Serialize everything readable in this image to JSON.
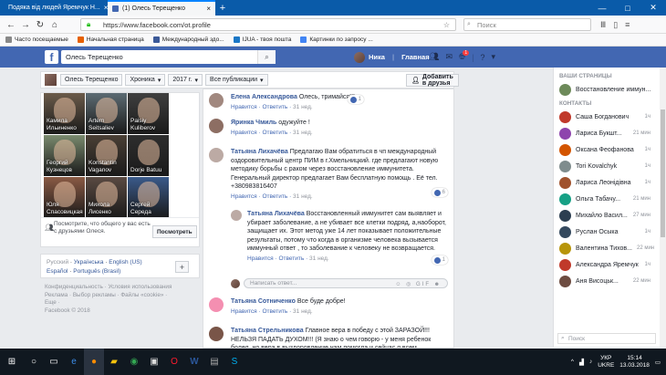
{
  "browser": {
    "tabs": [
      {
        "label": "Подяка від людей Яремчук Н...",
        "active": false
      },
      {
        "label": "(1) Олесь Терещенко",
        "active": true
      }
    ],
    "url": "https://www.facebook.com/ot.profile",
    "search_placeholder": "Поиск",
    "bookmarks": [
      {
        "label": "Часто посещаемые",
        "color": "#888888"
      },
      {
        "label": "Начальная страница",
        "color": "#e66000"
      },
      {
        "label": "Международный здо...",
        "color": "#3b5998"
      },
      {
        "label": "IJUA - твоя поштa",
        "color": "#1b77c6"
      },
      {
        "label": "Картинки по запросу ...",
        "color": "#4285f4"
      }
    ]
  },
  "facebook": {
    "search_value": "Олесь Терещенко",
    "user_name": "Ника",
    "home_label": "Главная",
    "notif_count": "1",
    "profile_name": "Олесь Терещенко",
    "timeline_label": "Хроника",
    "year": "2017 г.",
    "filter": "Все публикации",
    "add_friend": "Добавить в друзья"
  },
  "friends": [
    {
      "name": "Камила Ильиненко",
      "color": "#6b5b4a"
    },
    {
      "name": "Artem Seitsaliev",
      "color": "#5c6b73"
    },
    {
      "name": "Paisiy Kuliberov",
      "color": "#3f3f3f"
    },
    {
      "name": "Георгий Кузнецов",
      "color": "#7a8a6e"
    },
    {
      "name": "Konstantin Vaganov",
      "color": "#4a3f35"
    },
    {
      "name": "Dorje Batuu",
      "color": "#2e2e2e"
    },
    {
      "name": "Юля Спасовицкая",
      "color": "#8a5a44"
    },
    {
      "name": "Михола Лисенко",
      "color": "#5a4a42"
    },
    {
      "name": "Сергей Середа",
      "color": "#3a5a8a"
    }
  ],
  "find_friends": {
    "text": "Посмотрите, что общего у вас есть с друзьями Олеся.",
    "button": "Посмотреть"
  },
  "languages": {
    "current": "Русский",
    "others": [
      "Українська",
      "English (US)",
      "Español",
      "Português (Brasil)"
    ]
  },
  "footer": {
    "lines": [
      "Конфиденциальность · Условия использования",
      "Реклама · Выбор рекламы · Файлы «cookie» ·",
      "Еще ·",
      "Facebook © 2018"
    ]
  },
  "comments": [
    {
      "name": "Елена Александрова",
      "text": "Олесь, тримайся!!!",
      "reply": "Ответить",
      "time": "31 нед.",
      "likes": "1",
      "color": "#a1887f"
    },
    {
      "name": "Яринка Чмиль",
      "text": "одужуйте !",
      "reply": "Ответить",
      "time": "31 нед.",
      "likes": "",
      "color": "#8d6e63"
    },
    {
      "name": "Татьяна Лихачёва",
      "text": "Предлагаю Вам обратиться в чп международный оздоровительный центр ПИМ в г.Хмельницкий. где предлагают новую методику борьбы с раком через восстановление иммунитета. Генеральный директор предлагает Вам бесплатную помощь . Её тел. +380983816407",
      "action": "Нравится",
      "reply": "Ответить",
      "time": "31 нед.",
      "likes": "6",
      "color": "#bcaaa4"
    },
    {
      "name": "Татьяна Лихачёва",
      "text": "Восстановленный иммунитет сам выявляет и убирает заболевание, а не убивает все клетки подряд, а,наоборот, защищает их. Этот метод уже 14 лет показывает положительные результаты, потому что когда в организме человека вызывается иммунный ответ , то заболевание к человеку не возвращается.",
      "action": "Нравится",
      "reply": "Ответить",
      "time": "31 нед.",
      "likes": "1",
      "color": "#bcaaa4"
    },
    {
      "name": "Татьяна Сотниченко",
      "text": "Все буде добре!",
      "action": "Нравится",
      "reply": "Ответить",
      "time": "31 нед.",
      "likes": "",
      "color": "#f48fb1"
    },
    {
      "name": "Татьяна Стрельникова",
      "text": "Главное вера в победу с этой ЗАРАЗОЙ!!! НЕЛЬЗЯ ПАДАТЬ ДУХОМ!!! (Я знаю о чем говорю - у меня ребенок болел, но вера в выздоровление нам помогла и сейчас я всем",
      "action": "",
      "reply": "",
      "time": "",
      "likes": "",
      "color": "#795548"
    }
  ],
  "first_action": "Нравится",
  "reply_placeholder": "Написать ответ...",
  "sidebar": {
    "pages_title": "ВАШИ СТРАНИЦЫ",
    "page_name": "Восстановление иммун...",
    "contacts_title": "КОНТАКТЫ",
    "contacts": [
      {
        "name": "Саша Богданович",
        "status": "1ч",
        "color": "#c0392b"
      },
      {
        "name": "Лариса Букшт...",
        "status": "21 мин",
        "color": "#8e44ad"
      },
      {
        "name": "Оксана Феофанова",
        "status": "1ч",
        "color": "#d35400"
      },
      {
        "name": "Tori Kovalchyk",
        "status": "1ч",
        "color": "#7f8c8d"
      },
      {
        "name": "Лариса Леонідівна",
        "status": "1ч",
        "color": "#a0522d"
      },
      {
        "name": "Ольга Табачу...",
        "status": "21 мин",
        "color": "#16a085"
      },
      {
        "name": "Михайло Васил...",
        "status": "27 мин",
        "color": "#2c3e50"
      },
      {
        "name": "Руслан Осыка",
        "status": "1ч",
        "color": "#34495e"
      },
      {
        "name": "Валентина Тихов...",
        "status": "22 мин",
        "color": "#b7950b"
      },
      {
        "name": "Александра Яремчук",
        "status": "1ч",
        "color": "#c0392b"
      },
      {
        "name": "Аня Висоцьк...",
        "status": "22 мин",
        "color": "#6d4c41"
      }
    ],
    "search_placeholder": "Поиск"
  },
  "taskbar": {
    "lang": "УКР",
    "time": "15:14",
    "date": "13.03.2018",
    "kb": "UKRE"
  }
}
